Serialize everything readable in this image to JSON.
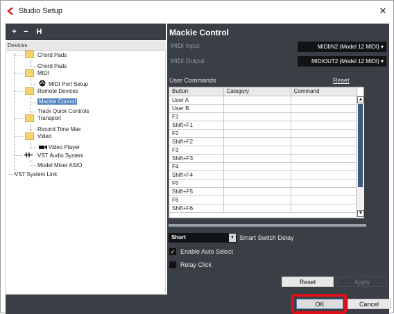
{
  "window": {
    "title": "Studio Setup",
    "close_icon": "close-icon"
  },
  "left": {
    "toolbar": [
      "+",
      "−",
      "H"
    ],
    "header": "Devices",
    "tree": [
      {
        "label": "Chord Pads",
        "type": "folder",
        "level": 1
      },
      {
        "label": "Chord Pads",
        "type": "item",
        "level": 2
      },
      {
        "label": "MIDI",
        "type": "folder",
        "level": 1
      },
      {
        "label": "MIDI Port Setup",
        "type": "item",
        "level": 2,
        "icon": "midi-icon"
      },
      {
        "label": "Remote Devices",
        "type": "folder",
        "level": 1
      },
      {
        "label": "Mackie Control",
        "type": "item",
        "level": 2,
        "selected": true
      },
      {
        "label": "Track Quick Controls",
        "type": "item",
        "level": 2
      },
      {
        "label": "Transport",
        "type": "folder",
        "level": 1
      },
      {
        "label": "Record Time Max",
        "type": "item",
        "level": 2
      },
      {
        "label": "Video",
        "type": "folder",
        "level": 1
      },
      {
        "label": "Video Player",
        "type": "item",
        "level": 2,
        "icon": "video-icon"
      },
      {
        "label": "VST Audio System",
        "type": "item",
        "level": 1,
        "icon": "audio-icon"
      },
      {
        "label": "Model Mixer ASIO",
        "type": "item",
        "level": 2
      },
      {
        "label": "VST System Link",
        "type": "item",
        "level": 0
      }
    ]
  },
  "right": {
    "title": "Mackie Control",
    "midi_input_label": "MIDI Input",
    "midi_input_value": "MIDIIN2 (Model 12 MIDI)",
    "midi_output_label": "MIDI Output",
    "midi_output_value": "MIDIOUT2 (Model 12 MIDI)",
    "user_commands_label": "User Commands",
    "reset_link": "Reset",
    "columns": [
      "Button",
      "Category",
      "Command"
    ],
    "rows": [
      "User A",
      "User B",
      "F1",
      "Shift+F1",
      "F2",
      "Shift+F2",
      "F3",
      "Shift+F3",
      "F4",
      "Shift+F4",
      "F5",
      "Shift+F5",
      "F6",
      "Shift+F6"
    ],
    "switch_value": "Short",
    "switch_label": "Smart Switch Delay",
    "enable_auto_select": "Enable Auto Select",
    "enable_auto_select_checked": true,
    "relay_click": "Relay Click",
    "relay_click_checked": false,
    "reset_button": "Reset",
    "apply_button": "Apply"
  },
  "footer": {
    "ok": "OK",
    "cancel": "Cancel"
  },
  "colors": {
    "panel": "#3a3f45",
    "selection": "#4b7fbf",
    "highlight": "#e0101a"
  }
}
